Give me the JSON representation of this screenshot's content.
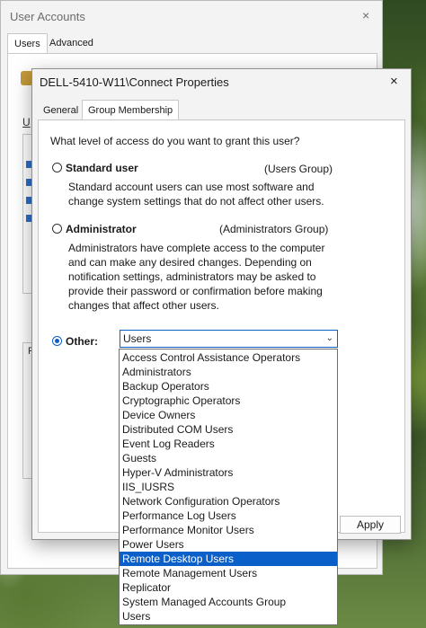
{
  "back_window": {
    "title": "User Accounts",
    "close_icon": "×",
    "tabs": [
      "Users",
      "Advanced"
    ],
    "underline_letter": "U",
    "p_letter": "P"
  },
  "dialog": {
    "title": "DELL-5410-W11\\Connect Properties",
    "close_icon": "×",
    "tabs": [
      "General",
      "Group Membership"
    ],
    "question": "What level of access do you want to grant this user?",
    "options": [
      {
        "label": "Standard user",
        "group": "(Users Group)",
        "description": "Standard account users can use most software and change system settings that do not affect other users."
      },
      {
        "label": "Administrator",
        "group": "(Administrators Group)",
        "description": "Administrators have complete access to the computer and can make any desired changes. Depending on notification settings, administrators may be asked to provide their password or confirmation before making changes that affect other users."
      },
      {
        "label": "Other:"
      }
    ],
    "selected_option": "Other:",
    "other_select_value": "Users",
    "apply_label": "Apply"
  },
  "dropdown": {
    "items": [
      "Access Control Assistance Operators",
      "Administrators",
      "Backup Operators",
      "Cryptographic Operators",
      "Device Owners",
      "Distributed COM Users",
      "Event Log Readers",
      "Guests",
      "Hyper-V Administrators",
      "IIS_IUSRS",
      "Network Configuration Operators",
      "Performance Log Users",
      "Performance Monitor Users",
      "Power Users",
      "Remote Desktop Users",
      "Remote Management Users",
      "Replicator",
      "System Managed Accounts Group",
      "Users"
    ],
    "highlighted_item": "Remote Desktop Users"
  },
  "colors": {
    "accent": "#0a5fc9",
    "dialog_bg": "#f3f3f3"
  }
}
